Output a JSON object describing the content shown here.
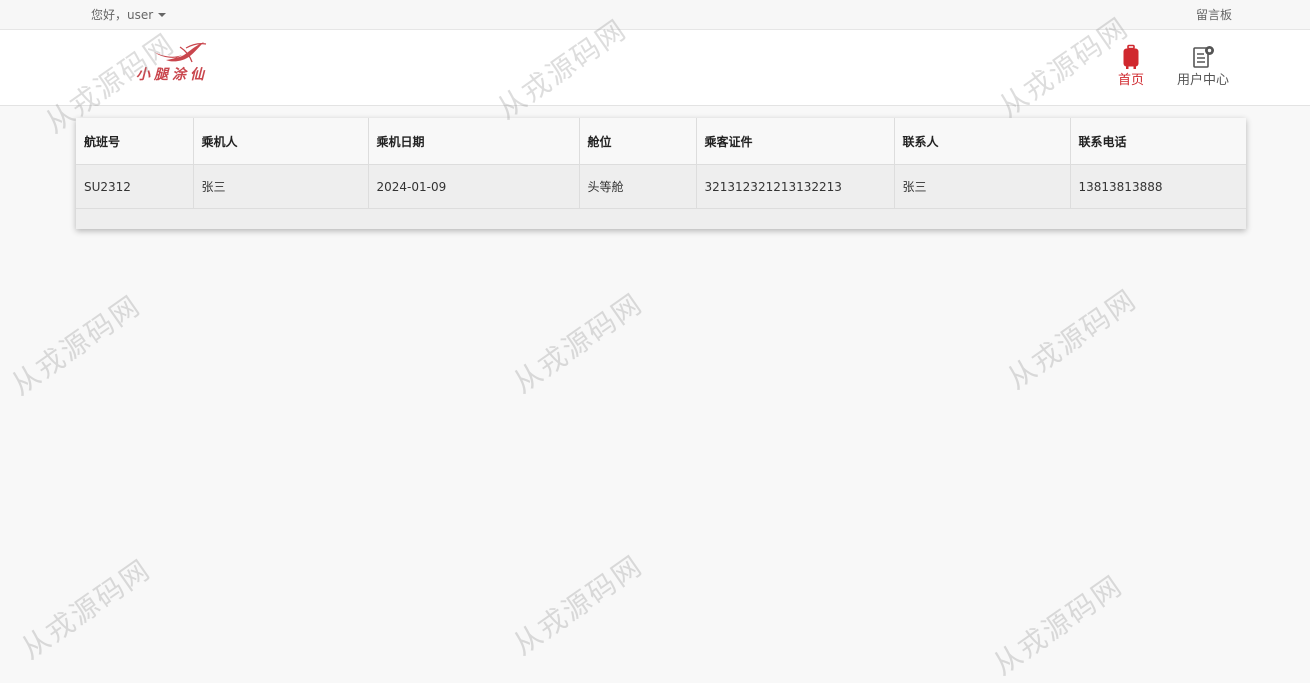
{
  "topbar": {
    "greeting": "您好，user",
    "board_link": "留言板"
  },
  "header": {
    "logo_text": "小腿涂仙",
    "nav": [
      {
        "label": "首页",
        "icon": "luggage-icon",
        "active": true
      },
      {
        "label": "用户中心",
        "icon": "user-settings-icon",
        "active": false
      }
    ]
  },
  "table": {
    "columns": [
      "航班号",
      "乘机人",
      "乘机日期",
      "舱位",
      "乘客证件",
      "联系人",
      "联系电话"
    ],
    "rows": [
      [
        "SU2312",
        "张三",
        "2024-01-09",
        "头等舱",
        "321312321213132213",
        "张三",
        "13813813888"
      ]
    ]
  },
  "watermark_text": "从戎源码网",
  "colors": {
    "accent": "#d0282e",
    "background": "#f8f8f8",
    "header_bg": "#ffffff"
  }
}
